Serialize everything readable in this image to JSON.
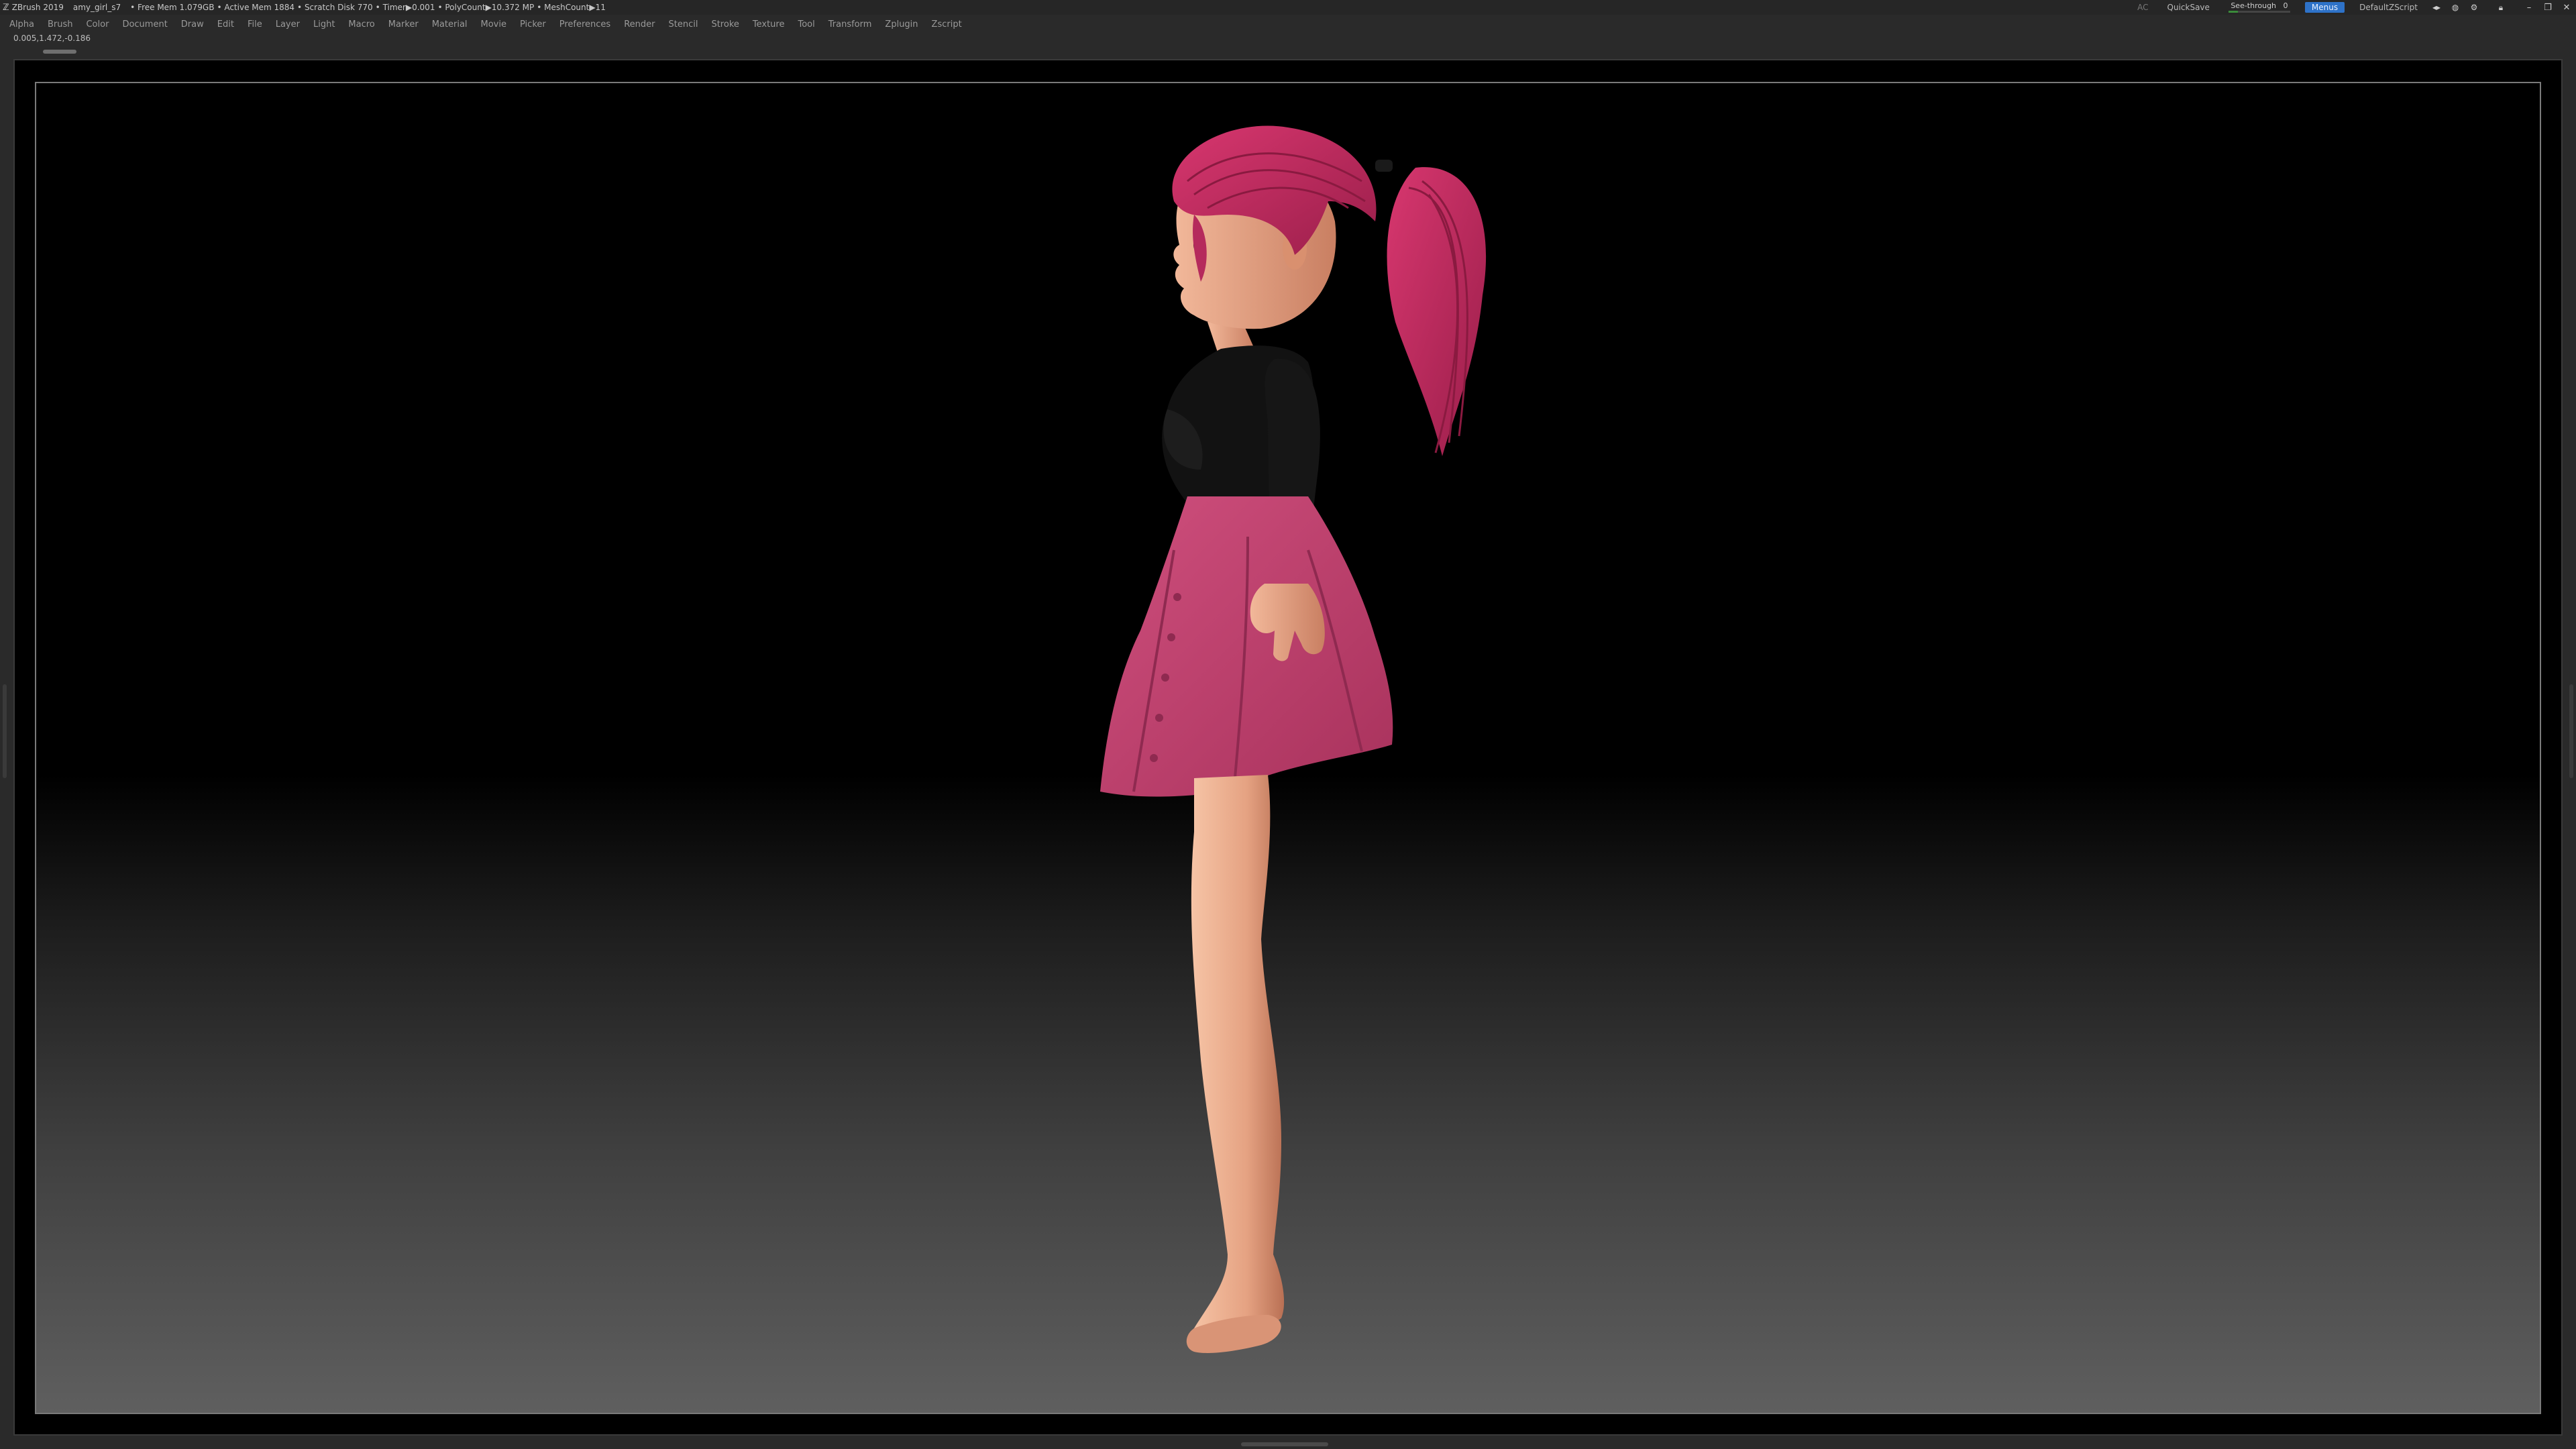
{
  "titlebar": {
    "app": "ZBrush 2019",
    "document": "amy_girl_s7",
    "stats": [
      "• Free Mem 1.079GB",
      "• Active Mem 1884",
      "• Scratch Disk 770",
      "• Timer▶0.001",
      "• PolyCount▶10.372 MP",
      "• MeshCount▶11"
    ],
    "ac_label": "AC",
    "quicksave_label": "QuickSave",
    "seethrough_label": "See-through",
    "seethrough_value": "0",
    "menus_label": "Menus",
    "script_label": "DefaultZScript"
  },
  "menubar": {
    "items": [
      "Alpha",
      "Brush",
      "Color",
      "Document",
      "Draw",
      "Edit",
      "File",
      "Layer",
      "Light",
      "Macro",
      "Marker",
      "Material",
      "Movie",
      "Picker",
      "Preferences",
      "Render",
      "Stencil",
      "Stroke",
      "Texture",
      "Tool",
      "Transform",
      "Zplugin",
      "Zscript"
    ]
  },
  "coords": "0.005,1.472,-0.186",
  "colors": {
    "skin": "#e8a585",
    "hair": "#c2285f",
    "skirt": "#c2406e",
    "top": "#121212",
    "menus_accent": "#2e72c8"
  },
  "icons": [
    "z-logo-icon",
    "help-icon",
    "palette-icon",
    "lock-icon",
    "minimize-icon",
    "restore-icon",
    "close-icon"
  ]
}
